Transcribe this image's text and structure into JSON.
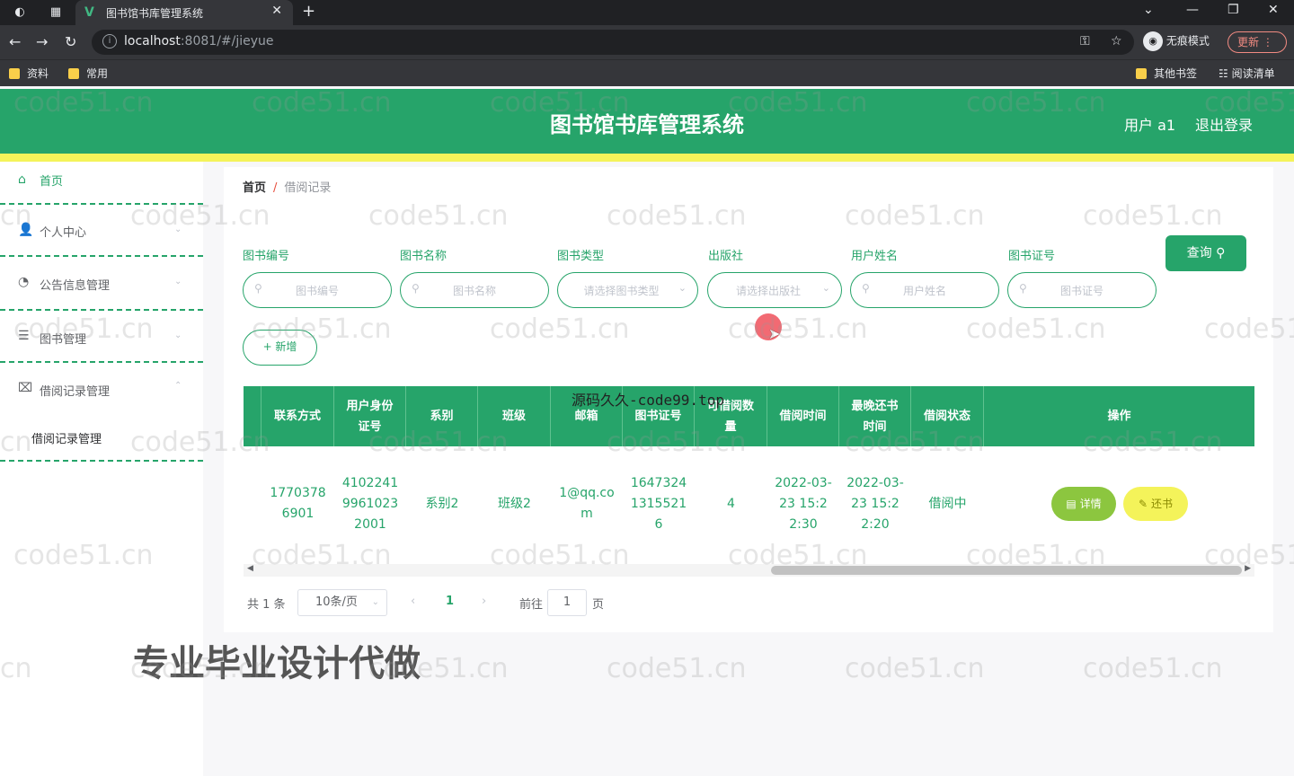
{
  "browser": {
    "tab_title": "图书馆书库管理系统",
    "url_host": "localhost",
    "url_rest": ":8081/#/jieyue",
    "profile_label": "无痕模式",
    "update_label": "更新",
    "bookmarks": [
      "资料",
      "常用"
    ],
    "bookmarks_right": [
      "其他书签",
      "阅读清单"
    ]
  },
  "header": {
    "title": "图书馆书库管理系统",
    "user": "用户 a1",
    "logout": "退出登录"
  },
  "sidebar": {
    "items": [
      {
        "label": "首页"
      },
      {
        "label": "个人中心"
      },
      {
        "label": "公告信息管理"
      },
      {
        "label": "图书管理"
      },
      {
        "label": "借阅记录管理"
      }
    ],
    "sub_item": "借阅记录管理"
  },
  "breadcrumb": {
    "home": "首页",
    "sep": "/",
    "current": "借阅记录"
  },
  "filters": [
    {
      "label": "图书编号",
      "placeholder": "图书编号"
    },
    {
      "label": "图书名称",
      "placeholder": "图书名称"
    },
    {
      "label": "图书类型",
      "placeholder": "请选择图书类型"
    },
    {
      "label": "出版社",
      "placeholder": "请选择出版社"
    },
    {
      "label": "用户姓名",
      "placeholder": "用户姓名"
    },
    {
      "label": "图书证号",
      "placeholder": "图书证号"
    }
  ],
  "buttons": {
    "query": "查询",
    "add": "+ 新增",
    "detail": "详情",
    "return": "还书"
  },
  "table": {
    "headers": [
      "联系方式",
      "用户身份证号",
      "系别",
      "班级",
      "邮箱",
      "图书证号",
      "可借阅数量",
      "借阅时间",
      "最晚还书时间",
      "借阅状态",
      "操作"
    ],
    "row": [
      "17703786901",
      "410224199610232001",
      "系别2",
      "班级2",
      "1@qq.com",
      "16473241315521 6",
      "4",
      "2022-03-23 15:22:30",
      "2022-03-23 15:22:20",
      "借阅中"
    ]
  },
  "pager": {
    "total": "共 1 条",
    "size": "10条/页",
    "current": "1",
    "goto": "前往",
    "page_input": "1",
    "page_unit": "页"
  },
  "overlays": {
    "top_text": "源码久久-code99.top",
    "big_text": "专业毕业设计代做",
    "watermark": "code51.cn"
  },
  "colors": {
    "primary": "#26a46a",
    "accent_yellow": "#f4f35a",
    "detail_green": "#8cc63f"
  }
}
